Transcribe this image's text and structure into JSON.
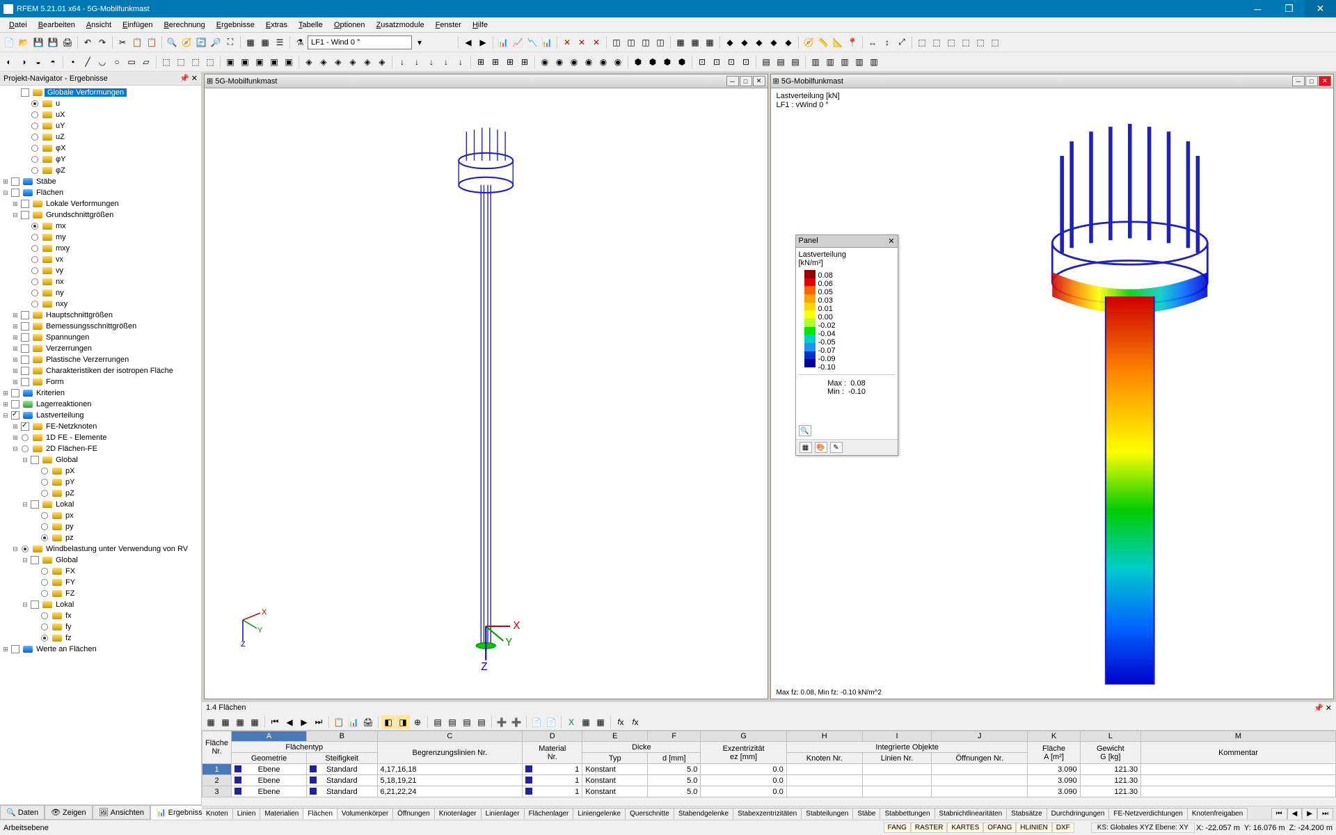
{
  "app": {
    "title": "RFEM 5.21.01 x64 - 5G-Mobilfunkmast",
    "menus": [
      "Datei",
      "Bearbeiten",
      "Ansicht",
      "Einfügen",
      "Berechnung",
      "Ergebnisse",
      "Extras",
      "Tabelle",
      "Optionen",
      "Zusatzmodule",
      "Fenster",
      "Hilfe"
    ],
    "load_case_combo": "LF1 - Wind 0 °"
  },
  "navigator": {
    "title": "Projekt-Navigator - Ergebnisse",
    "tree": {
      "globale_verformungen": "Globale Verformungen",
      "u": "u",
      "ux": "uX",
      "uy": "uY",
      "uz": "uZ",
      "phix": "φX",
      "phiy": "φY",
      "phiz": "φZ",
      "staebe": "Stäbe",
      "flaechen": "Flächen",
      "lokale_verformungen": "Lokale Verformungen",
      "grundschnittgroessen": "Grundschnittgrößen",
      "mx": "mx",
      "my": "my",
      "mxy": "mxy",
      "vx": "vx",
      "vy": "vy",
      "nx": "nx",
      "ny": "ny",
      "nxy": "nxy",
      "hauptschnitt": "Hauptschnittgrößen",
      "bemessungsschnitt": "Bemessungsschnittgrößen",
      "spannungen": "Spannungen",
      "verzerrungen": "Verzerrungen",
      "plastische": "Plastische Verzerrungen",
      "charakteristiken": "Charakteristiken der isotropen Fläche",
      "form": "Form",
      "kriterien": "Kriterien",
      "lagerreaktionen": "Lagerreaktionen",
      "lastverteilung": "Lastverteilung",
      "fe_netzknoten": "FE-Netzknoten",
      "fe_1d": "1D FE - Elemente",
      "fe_2d": "2D Flächen-FE",
      "global": "Global",
      "px": "pX",
      "py": "pY",
      "pz": "pZ",
      "lokal": "Lokal",
      "plx": "px",
      "ply": "py",
      "plz": "pz",
      "windbelastung": "Windbelastung unter Verwendung von RV",
      "fx": "FX",
      "fy": "FY",
      "fz": "FZ",
      "fxl": "fx",
      "fyl": "fy",
      "fzl": "fz",
      "werte_flaechen": "Werte an Flächen"
    },
    "bottom_tabs": [
      "Daten",
      "Zeigen",
      "Ansichten",
      "Ergebnisse"
    ]
  },
  "viewports": {
    "vp1_title": "5G-Mobilfunkmast",
    "vp2_title": "5G-Mobilfunkmast",
    "vp2_info_1": "Lastverteilung [kN]",
    "vp2_info_2": "LF1 : vWind 0 °",
    "vp2_footer": "Max fz: 0.08, Min fz: -0.10 kN/m^2"
  },
  "legend": {
    "title": "Panel",
    "subtitle": "Lastverteilung",
    "unit": "[kN/m²]",
    "values": [
      "0.08",
      "0.06",
      "0.05",
      "0.03",
      "0.01",
      "0.00",
      "-0.02",
      "-0.04",
      "-0.05",
      "-0.07",
      "-0.09",
      "-0.10"
    ],
    "colors": [
      "#980000",
      "#e30000",
      "#ff6600",
      "#ffa500",
      "#ffd700",
      "#ffff00",
      "#adff2f",
      "#00e600",
      "#00ced1",
      "#1e90ff",
      "#0033cc",
      "#000099"
    ],
    "max_label": "Max :",
    "max_value": "0.08",
    "min_label": "Min :",
    "min_value": "-0.10"
  },
  "table": {
    "title": "1.4 Flächen",
    "col_letters": [
      "A",
      "B",
      "C",
      "D",
      "E",
      "F",
      "G",
      "H",
      "I",
      "J",
      "K",
      "L",
      "M"
    ],
    "group_headers": {
      "flaeche_nr": "Fläche\nNr.",
      "flaechentyp": "Flächentyp",
      "material_nr": "Material\nNr.",
      "dicke": "Dicke",
      "exzentrizitaet": "Exzentrizität",
      "integrierte": "Integrierte Objekte",
      "flaeche": "Fläche",
      "gewicht": "Gewicht",
      "kommentar": "Kommentar"
    },
    "sub_headers": {
      "geometrie": "Geometrie",
      "steifigkeit": "Steifigkeit",
      "begrenzung": "Begrenzungslinien Nr.",
      "typ": "Typ",
      "d": "d [mm]",
      "ez": "ez [mm]",
      "knoten": "Knoten Nr.",
      "linien": "Linien Nr.",
      "oeffnungen": "Öffnungen Nr.",
      "a": "A [m²]",
      "g": "G [kg]"
    },
    "rows": [
      {
        "nr": "1",
        "geo": "Ebene",
        "stf": "Standard",
        "beg": "4,17,16,18",
        "mat": "1",
        "typ": "Konstant",
        "d": "5.0",
        "ez": "0.0",
        "kn": "",
        "ln": "",
        "of": "",
        "a": "3.090",
        "g": "121.30",
        "kom": ""
      },
      {
        "nr": "2",
        "geo": "Ebene",
        "stf": "Standard",
        "beg": "5,18,19,21",
        "mat": "1",
        "typ": "Konstant",
        "d": "5.0",
        "ez": "0.0",
        "kn": "",
        "ln": "",
        "of": "",
        "a": "3.090",
        "g": "121.30",
        "kom": ""
      },
      {
        "nr": "3",
        "geo": "Ebene",
        "stf": "Standard",
        "beg": "6,21,22,24",
        "mat": "1",
        "typ": "Konstant",
        "d": "5.0",
        "ez": "0.0",
        "kn": "",
        "ln": "",
        "of": "",
        "a": "3.090",
        "g": "121.30",
        "kom": ""
      }
    ],
    "bottom_tabs": [
      "Knoten",
      "Linien",
      "Materialien",
      "Flächen",
      "Volumenkörper",
      "Öffnungen",
      "Knotenlager",
      "Linienlager",
      "Flächenlager",
      "Liniengelenke",
      "Querschnitte",
      "Stabendgelenke",
      "Stabexzentrizitäten",
      "Stabteilungen",
      "Stäbe",
      "Stabbettungen",
      "Stabnichtlinearitäten",
      "Stabsätze",
      "Durchdringungen",
      "FE-Netzverdichtungen",
      "Knotenfreigaben"
    ]
  },
  "status": {
    "left": "Arbeitsebene",
    "flags": [
      "FANG",
      "RASTER",
      "KARTES",
      "OFANG",
      "HLINIEN",
      "DXF"
    ],
    "ks": "KS: Globales XYZ Ebene: XY",
    "x": "X: -22.057 m",
    "y": "Y: 16.076 m",
    "z": "Z: -24.200 m"
  }
}
